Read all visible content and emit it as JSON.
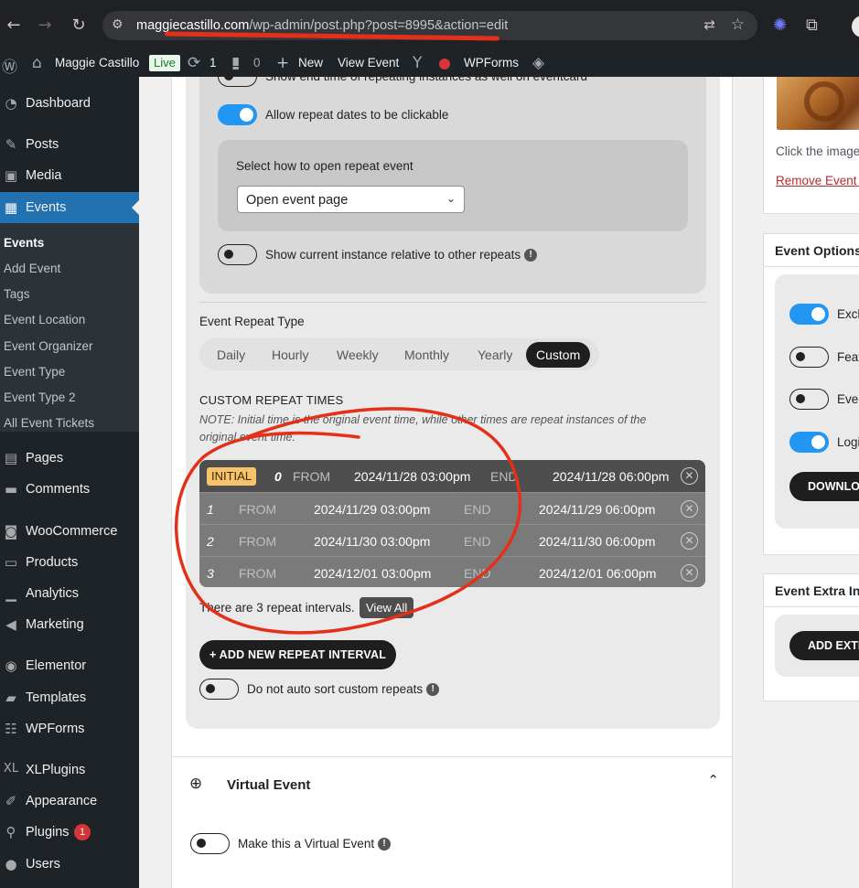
{
  "browser": {
    "url_host": "maggiecastillo.com",
    "url_path": "/wp-admin/post.php?post=8995&action=edit",
    "icons": [
      "back-icon",
      "forward-icon",
      "reload-icon",
      "tune-icon",
      "translate-icon",
      "star-icon",
      "extension-icon",
      "puzzle-icon"
    ],
    "accent_color": "#e53019"
  },
  "admin_bar": {
    "site_name": "Maggie Castillo",
    "live_badge": "Live",
    "updates_count": "1",
    "comments_count": "0",
    "new_label": "New",
    "view_event": "View Event",
    "wpforms": "WPForms"
  },
  "sidebar": {
    "items": [
      {
        "label": "Dashboard",
        "icon": "dashboard-icon"
      },
      {
        "label": "Posts",
        "icon": "pin-icon"
      },
      {
        "label": "Media",
        "icon": "media-icon"
      },
      {
        "label": "Events",
        "icon": "calendar-icon"
      },
      {
        "label": "Pages",
        "icon": "pages-icon"
      },
      {
        "label": "Comments",
        "icon": "comment-icon"
      },
      {
        "label": "WooCommerce",
        "icon": "woo-icon"
      },
      {
        "label": "Products",
        "icon": "products-icon"
      },
      {
        "label": "Analytics",
        "icon": "analytics-icon"
      },
      {
        "label": "Marketing",
        "icon": "megaphone-icon"
      },
      {
        "label": "Elementor",
        "icon": "elementor-icon"
      },
      {
        "label": "Templates",
        "icon": "folder-icon"
      },
      {
        "label": "WPForms",
        "icon": "forms-icon"
      },
      {
        "label": "XLPlugins",
        "icon": "xl-icon"
      },
      {
        "label": "Appearance",
        "icon": "brush-icon"
      },
      {
        "label": "Plugins",
        "icon": "plug-icon"
      },
      {
        "label": "Users",
        "icon": "user-icon"
      }
    ],
    "plugins_badge": "1",
    "submenu": [
      "Events",
      "Add Event",
      "Tags",
      "Event Location",
      "Event Organizer",
      "Event Type",
      "Event Type 2",
      "All Event Tickets"
    ]
  },
  "repeat": {
    "show_end_time_label": "Show end time of repeating instances as well on eventcard",
    "clickable_label": "Allow repeat dates to be clickable",
    "open_how_label": "Select how to open repeat event",
    "open_select_value": "Open event page",
    "relative_label": "Show current instance relative to other repeats",
    "type_label": "Event Repeat Type",
    "tabs": [
      "Daily",
      "Hourly",
      "Weekly",
      "Monthly",
      "Yearly",
      "Custom"
    ],
    "active_tab": "Custom",
    "custom_title": "CUSTOM REPEAT TIMES",
    "custom_note": "NOTE: Initial time is the original event time, while other times are repeat instances of the original event time.",
    "from_label": "FROM",
    "end_label": "END",
    "initial_badge": "INITIAL",
    "rows": [
      {
        "num": "0",
        "from": "2024/11/28 03:00pm",
        "end": "2024/11/28 06:00pm"
      },
      {
        "num": "1",
        "from": "2024/11/29 03:00pm",
        "end": "2024/11/29 06:00pm"
      },
      {
        "num": "2",
        "from": "2024/11/30 03:00pm",
        "end": "2024/11/30 06:00pm"
      },
      {
        "num": "3",
        "from": "2024/12/01 03:00pm",
        "end": "2024/12/01 06:00pm"
      }
    ],
    "intervals_text": "There are 3 repeat intervals.",
    "view_all": "View All",
    "add_interval": "+ ADD NEW REPEAT INTERVAL",
    "no_sort_label": "Do not auto sort custom repeats"
  },
  "virtual": {
    "title": "Virtual Event",
    "make_virtual_label": "Make this a Virtual Event"
  },
  "right": {
    "image_hint": "Click the image",
    "remove_link": "Remove Event i",
    "options_title": "Event Options",
    "options": [
      "Excl",
      "Feat",
      "Even",
      "Logi"
    ],
    "download_label": "DOWNLO",
    "extra_title": "Event Extra In",
    "add_extra_label": "ADD EXTR"
  }
}
